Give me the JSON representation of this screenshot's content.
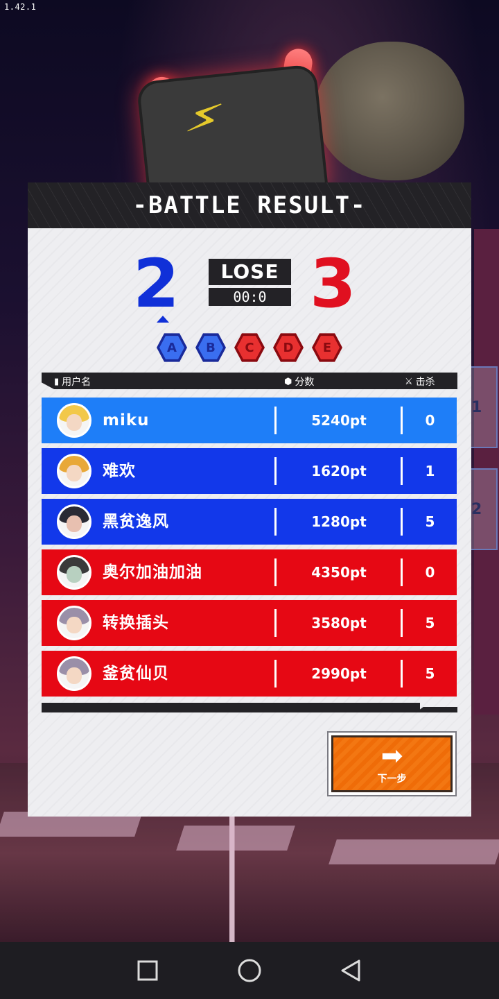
{
  "version": "1.42.1",
  "header": {
    "title": "-BATTLE RESULT-"
  },
  "score": {
    "blue": "2",
    "red": "3",
    "result": "LOSE",
    "time": "00:0"
  },
  "rounds": [
    "A",
    "B",
    "C",
    "D",
    "E"
  ],
  "table": {
    "col_user": "用户名",
    "col_score": "分数",
    "col_kills": "击杀",
    "rows": [
      {
        "name": "miku",
        "score": "5240pt",
        "kills": "0",
        "team": "blue"
      },
      {
        "name": "难欢",
        "score": "1620pt",
        "kills": "1",
        "team": "blue"
      },
      {
        "name": "黑贫逸风",
        "score": "1280pt",
        "kills": "5",
        "team": "blue"
      },
      {
        "name": "奥尔加油加油",
        "score": "4350pt",
        "kills": "0",
        "team": "red"
      },
      {
        "name": "转换插头",
        "score": "3580pt",
        "kills": "5",
        "team": "red"
      },
      {
        "name": "釜贫仙贝",
        "score": "2990pt",
        "kills": "5",
        "team": "red"
      }
    ]
  },
  "side_tabs": [
    "1",
    "2"
  ],
  "next_button": {
    "label": "下一步"
  },
  "colors": {
    "blue": "#1238ea",
    "red": "#e60814",
    "accent": "#f37712"
  }
}
